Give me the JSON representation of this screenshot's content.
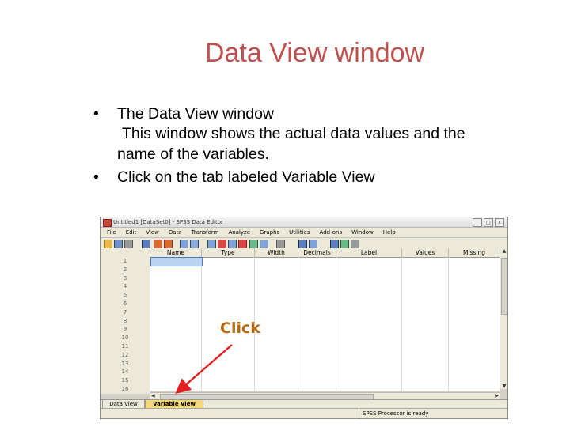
{
  "slide": {
    "title": "Data View window",
    "bullet1": "The Data View window",
    "bullet1_sub_line1": "This window shows the actual data values and the",
    "bullet1_sub_line2": "name of the variables.",
    "bullet2": "Click on the tab labeled Variable View",
    "callout": "Click",
    "bullet_glyph": "•"
  },
  "window": {
    "title": "Untitled1 [DataSet0] - SPSS Data Editor",
    "menu": [
      "File",
      "Edit",
      "View",
      "Data",
      "Transform",
      "Analyze",
      "Graphs",
      "Utilities",
      "Add-ons",
      "Window",
      "Help"
    ],
    "columns": [
      "Name",
      "Type",
      "Width",
      "Decimals",
      "Label",
      "Values",
      "Missing"
    ],
    "rows": [
      "1",
      "2",
      "3",
      "4",
      "5",
      "6",
      "7",
      "8",
      "9",
      "10",
      "11",
      "12",
      "13",
      "14",
      "15",
      "16"
    ],
    "tabs": {
      "data_view": "Data View",
      "variable_view": "Variable View"
    },
    "status": "SPSS  Processor is ready",
    "window_buttons": [
      "_",
      "□",
      "x"
    ]
  },
  "colors": {
    "title": "#c0504d",
    "callout": "#b4690e",
    "arrow": "#e02020",
    "active_tab": "#f6d87a"
  }
}
